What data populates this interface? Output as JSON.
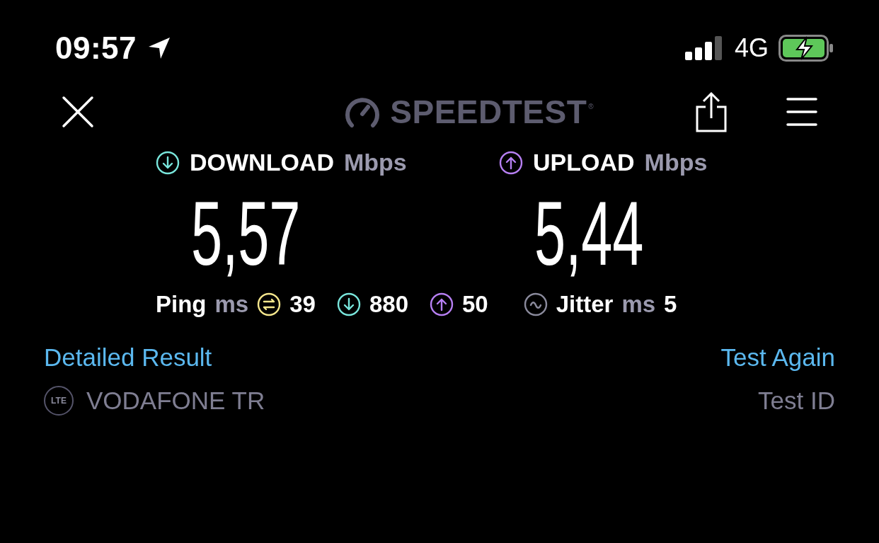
{
  "status_bar": {
    "time": "09:57",
    "network": "4G"
  },
  "header": {
    "logo": {
      "text": "SPEEDTEST",
      "mark": "®"
    }
  },
  "results": [
    {
      "kind": "download",
      "label": "DOWNLOAD",
      "unit": "Mbps",
      "value": "5,57",
      "color": "#79e6dc"
    },
    {
      "kind": "upload",
      "label": "UPLOAD",
      "unit": "Mbps",
      "value": "5,44",
      "color": "#b67ff2"
    }
  ],
  "latency": {
    "label": "Ping",
    "unit": "ms",
    "items": [
      {
        "kind": "ping",
        "value": "39",
        "color": "#f5e68c"
      },
      {
        "kind": "download",
        "value": "880",
        "color": "#79e6dc"
      },
      {
        "kind": "upload",
        "value": "50",
        "color": "#b67ff2"
      }
    ]
  },
  "jitter": {
    "label": "Jitter",
    "unit": "ms",
    "value": "5"
  },
  "links": {
    "left": "Detailed Result",
    "right": "Test Again"
  },
  "provider": {
    "badge": "LTE",
    "name": "VODAFONE TR",
    "test_id": "Test ID"
  }
}
